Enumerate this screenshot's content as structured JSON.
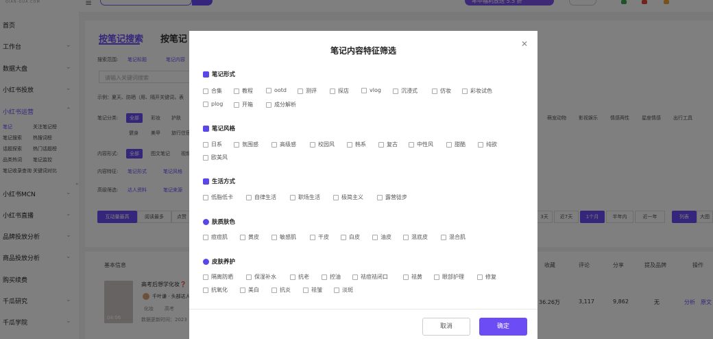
{
  "topbar": {
    "logo": "QIAN-GUA.COM",
    "promo": "年中福利放送 5.5 折"
  },
  "sidebar": {
    "items": [
      {
        "label": "首页"
      },
      {
        "label": "工作台"
      },
      {
        "label": "数据大盘"
      },
      {
        "label": "小红书投放"
      },
      {
        "label": "小红书运营"
      },
      {
        "label": "小红书MCN"
      },
      {
        "label": "小红书直播"
      },
      {
        "label": "品牌投放分析"
      },
      {
        "label": "商品投放分析"
      },
      {
        "label": "购买续费"
      },
      {
        "label": "千瓜研究"
      },
      {
        "label": "千瓜学院"
      }
    ],
    "subitems": [
      "笔记",
      "关注笔记榜",
      "笔记搜索",
      "热搜词榜",
      "话题探索",
      "热门话题榜",
      "品类热词",
      "笔记监控",
      "笔记收录查询",
      "关键词对比"
    ]
  },
  "main": {
    "tab1": "按笔记搜索",
    "tab2": "按笔记",
    "search_scope_label": "搜索范围:",
    "scope_opts": [
      "笔记标题",
      "笔记内容"
    ],
    "keyword_placeholder": "请输入关键词搜索",
    "example_text": "示例：夏天、防晒（用、隔开关键词，表",
    "category_label": "笔记分类:",
    "categories": [
      "全部",
      "彩妆",
      "护肤"
    ],
    "categories_row2": [
      "健身",
      "美甲",
      "旅行住宿"
    ],
    "categories_right": [
      "萌宠动物",
      "影视娱乐",
      "情感两性",
      "星座情感",
      "出行工具"
    ],
    "content_form_label": "内容形式:",
    "content_forms": [
      "全部",
      "图文笔记",
      "视频"
    ],
    "content_feature_label": "内容特征:",
    "content_features": [
      "笔记形式",
      "笔记风格"
    ],
    "advanced_label": "高级筛选:",
    "advanced_opts": [
      "达人资料",
      "笔记来源"
    ],
    "sort_tabs": [
      "互动量最高",
      "阅读最多",
      "点赞"
    ],
    "time_tabs": [
      "3天",
      "近7天",
      "1个月",
      "半年内",
      "近一年"
    ],
    "view_tabs": [
      "列表",
      "大图"
    ]
  },
  "table": {
    "headers": [
      "基本信息",
      "收藏",
      "评论",
      "分享",
      "提及品牌",
      "操作"
    ],
    "row": {
      "title": "高考后想学化妆❓",
      "author": "千叶谦 · 头部达人",
      "tags": [
        "化妆",
        "高考"
      ],
      "updated": "数据更新时间：2023",
      "duration": "04:06",
      "favorites": "36.26万",
      "comments": "3,117",
      "shares": "9,862",
      "brand": "无",
      "actions": [
        "分析",
        "原文"
      ]
    }
  },
  "modal": {
    "title": "笔记内容特征筛选",
    "cancel": "取消",
    "confirm": "确定",
    "sections": [
      {
        "title": "笔记形式",
        "icon": "document-icon",
        "options": [
          "合集",
          "教程",
          "ootd",
          "测评",
          "探店",
          "vlog",
          "沉浸式",
          "仿妆",
          "彩妆试色",
          "plog",
          "开箱",
          "成分解析"
        ]
      },
      {
        "title": "笔记风格",
        "icon": "bookmark-icon",
        "options": [
          "日系",
          "氛围感",
          "高级感",
          "校园风",
          "韩系",
          "复古",
          "中性风",
          "甜酷",
          "纯欲",
          "欧美风"
        ]
      },
      {
        "title": "生活方式",
        "icon": "cup-icon",
        "options": [
          "低脂低卡",
          "自律生活",
          "职场生活",
          "极简主义",
          "露营徒步"
        ]
      },
      {
        "title": "肤质肤色",
        "icon": "face-icon",
        "options": [
          "痘痘肌",
          "黄皮",
          "敏感肌",
          "干皮",
          "白皮",
          "油皮",
          "混底皮",
          "混合肌"
        ]
      },
      {
        "title": "皮肤养护",
        "icon": "drop-icon",
        "options": [
          "隔离防晒",
          "保湿补水",
          "抗老",
          "控油",
          "祛痘祛闭口",
          "祛黄",
          "眼部护理",
          "修复",
          "抗氧化",
          "美白",
          "抗炎",
          "祛皱",
          "淡斑"
        ]
      }
    ]
  },
  "colors": {
    "accent": "#6c4cf5",
    "overlay": "rgba(0,0,0,0.5)"
  }
}
